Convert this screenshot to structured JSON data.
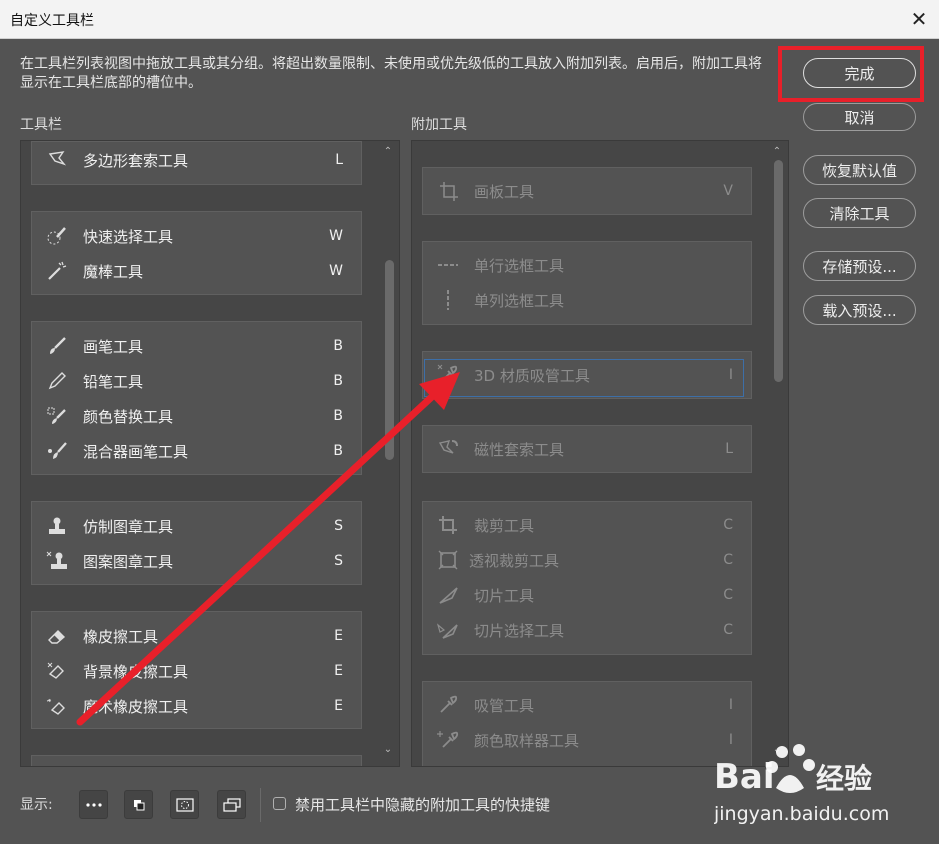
{
  "window": {
    "title": "自定义工具栏"
  },
  "description": "在工具栏列表视图中拖放工具或其分组。将超出数量限制、未使用或优先级低的工具放入附加列表。启用后，附加工具将显示在工具栏底部的槽位中。",
  "toolbar_panel": {
    "label": "工具栏",
    "groups": [
      {
        "items": [
          {
            "label": "多边形套索工具",
            "key": "L",
            "icon": "polygon-lasso-icon"
          }
        ]
      },
      {
        "items": [
          {
            "label": "快速选择工具",
            "key": "W",
            "icon": "quick-select-icon"
          },
          {
            "label": "魔棒工具",
            "key": "W",
            "icon": "magic-wand-icon"
          }
        ]
      },
      {
        "items": [
          {
            "label": "画笔工具",
            "key": "B",
            "icon": "brush-icon"
          },
          {
            "label": "铅笔工具",
            "key": "B",
            "icon": "pencil-icon"
          },
          {
            "label": "颜色替换工具",
            "key": "B",
            "icon": "color-replace-icon"
          },
          {
            "label": "混合器画笔工具",
            "key": "B",
            "icon": "mixer-brush-icon"
          }
        ]
      },
      {
        "items": [
          {
            "label": "仿制图章工具",
            "key": "S",
            "icon": "clone-stamp-icon"
          },
          {
            "label": "图案图章工具",
            "key": "S",
            "icon": "pattern-stamp-icon"
          }
        ]
      },
      {
        "items": [
          {
            "label": "橡皮擦工具",
            "key": "E",
            "icon": "eraser-icon"
          },
          {
            "label": "背景橡皮擦工具",
            "key": "E",
            "icon": "background-eraser-icon"
          },
          {
            "label": "魔术橡皮擦工具",
            "key": "E",
            "icon": "magic-eraser-icon"
          }
        ]
      }
    ]
  },
  "extra_panel": {
    "label": "附加工具",
    "groups": [
      {
        "items": [
          {
            "label": "画板工具",
            "key": "V",
            "icon": "artboard-icon"
          }
        ]
      },
      {
        "items": [
          {
            "label": "单行选框工具",
            "key": "",
            "icon": "single-row-marquee-icon"
          },
          {
            "label": "单列选框工具",
            "key": "",
            "icon": "single-column-marquee-icon"
          }
        ]
      },
      {
        "items": [
          {
            "label": "3D 材质吸管工具",
            "key": "I",
            "icon": "3d-eyedropper-icon"
          }
        ]
      },
      {
        "items": [
          {
            "label": "磁性套索工具",
            "key": "L",
            "icon": "magnetic-lasso-icon"
          }
        ]
      },
      {
        "items": [
          {
            "label": "裁剪工具",
            "key": "C",
            "icon": "crop-icon"
          },
          {
            "label": "透视裁剪工具",
            "key": "C",
            "icon": "perspective-crop-icon"
          },
          {
            "label": "切片工具",
            "key": "C",
            "icon": "slice-icon"
          },
          {
            "label": "切片选择工具",
            "key": "C",
            "icon": "slice-select-icon"
          }
        ]
      },
      {
        "items": [
          {
            "label": "吸管工具",
            "key": "I",
            "icon": "eyedropper-icon"
          },
          {
            "label": "颜色取样器工具",
            "key": "I",
            "icon": "color-sampler-icon"
          }
        ]
      }
    ]
  },
  "buttons": {
    "done": "完成",
    "cancel": "取消",
    "restore_defaults": "恢复默认值",
    "clear_tools": "清除工具",
    "save_preset": "存储预设...",
    "load_preset": "载入预设..."
  },
  "footer": {
    "show_label": "显示:",
    "checkbox_label": "禁用工具栏中隐藏的附加工具的快捷键",
    "checkbox_checked": false
  },
  "annotation": {
    "highlight_color": "#e8202a",
    "arrow_color": "#e8202a"
  },
  "watermark": {
    "brand": "Bai",
    "brand2": "经验",
    "url": "jingyan.baidu.com"
  }
}
